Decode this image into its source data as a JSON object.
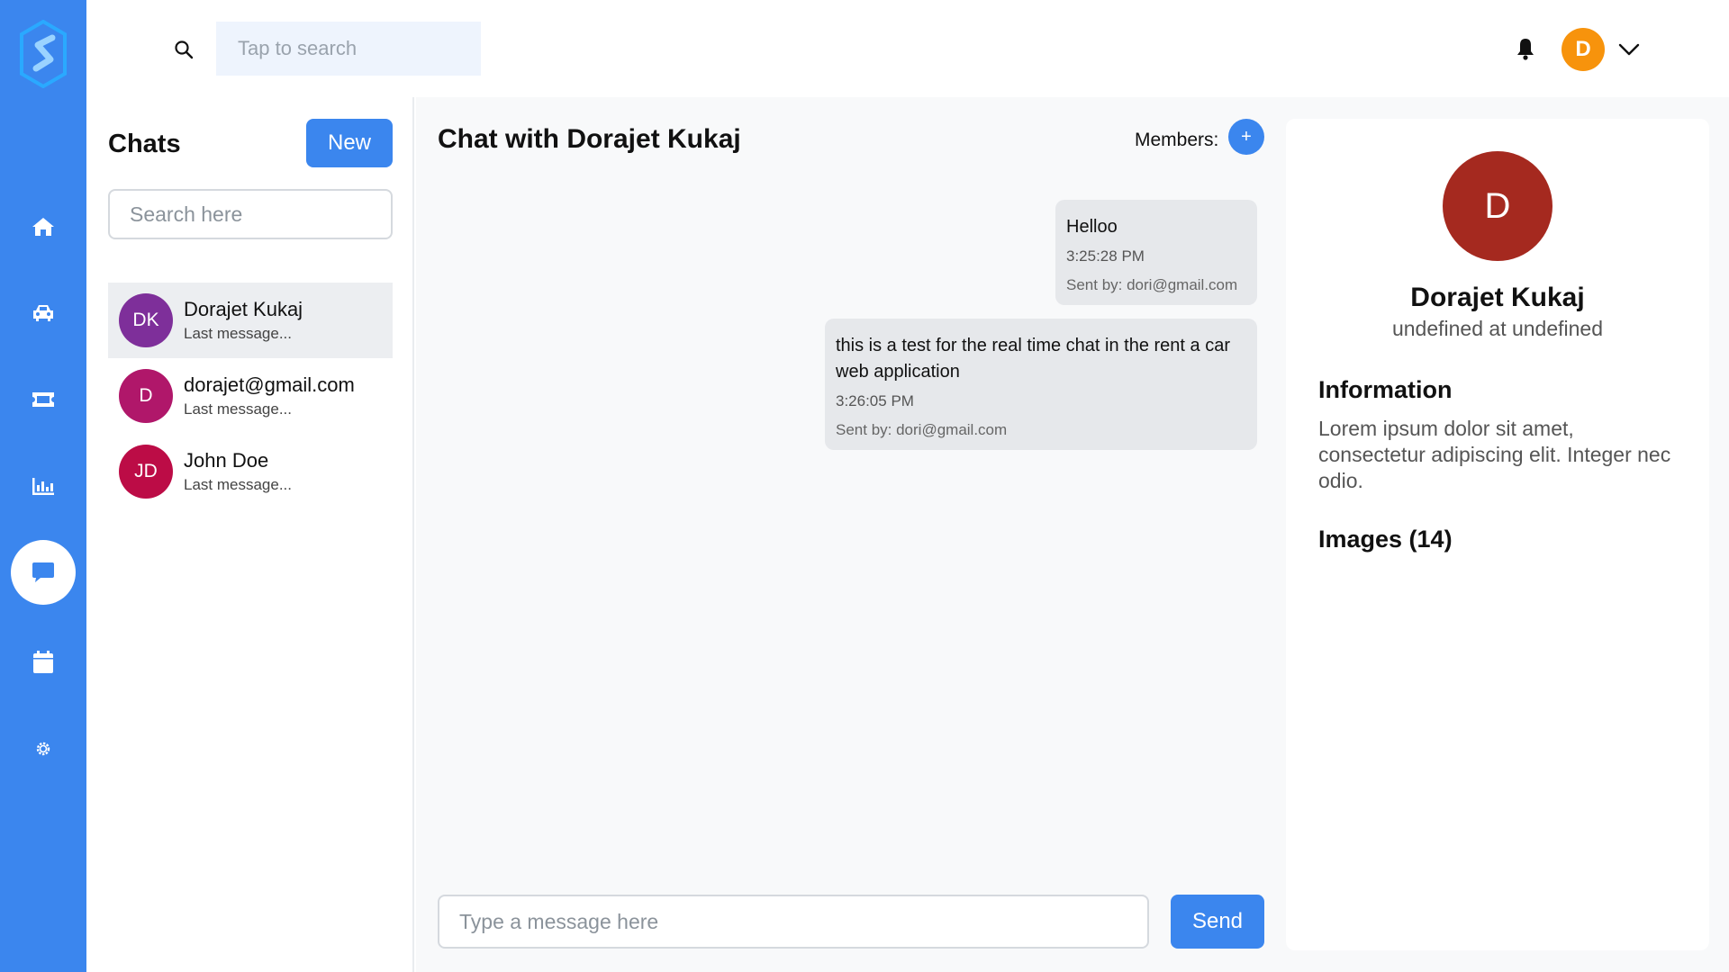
{
  "sidebar": {
    "logo": "s-logo-icon",
    "items": [
      {
        "icon": "home-icon",
        "active": false
      },
      {
        "icon": "car-icon",
        "active": false
      },
      {
        "icon": "ticket-icon",
        "active": false
      },
      {
        "icon": "bar-chart-icon",
        "active": false
      },
      {
        "icon": "chat-icon",
        "active": true
      },
      {
        "icon": "calendar-icon",
        "active": false
      },
      {
        "icon": "gear-icon",
        "active": false
      }
    ],
    "color": "#3b86ee"
  },
  "topbar": {
    "search_placeholder": "Tap to search",
    "avatar_initial": "D",
    "avatar_color": "#f7930c"
  },
  "chat_list": {
    "title": "Chats",
    "new_label": "New",
    "search_placeholder": "Search here",
    "items": [
      {
        "initials": "DK",
        "name": "Dorajet Kukaj",
        "last": "Last message...",
        "color": "#7e2f9a",
        "selected": true
      },
      {
        "initials": "D",
        "name": "dorajet@gmail.com",
        "last": "Last message...",
        "color": "#b0176a",
        "selected": false
      },
      {
        "initials": "JD",
        "name": "John Doe",
        "last": "Last message...",
        "color": "#bc0c46",
        "selected": false
      }
    ]
  },
  "conversation": {
    "title": "Chat with Dorajet Kukaj",
    "members_label": "Members:",
    "add_member_label": "+",
    "messages": [
      {
        "text": "Helloo",
        "time": "3:25:28 PM",
        "sender": "Sent by: dori@gmail.com"
      },
      {
        "text": "this is a test for the real time chat in the rent a car web application",
        "time": "3:26:05 PM",
        "sender": "Sent by: dori@gmail.com"
      }
    ],
    "input_placeholder": "Type a message here",
    "send_label": "Send"
  },
  "info": {
    "avatar_initial": "D",
    "avatar_color": "#a5291f",
    "name": "Dorajet Kukaj",
    "subtitle": "undefined at undefined",
    "information_heading": "Information",
    "information_text": "Lorem ipsum dolor sit amet, consectetur adipiscing elit. Integer nec odio.",
    "images_heading": "Images (14)"
  }
}
